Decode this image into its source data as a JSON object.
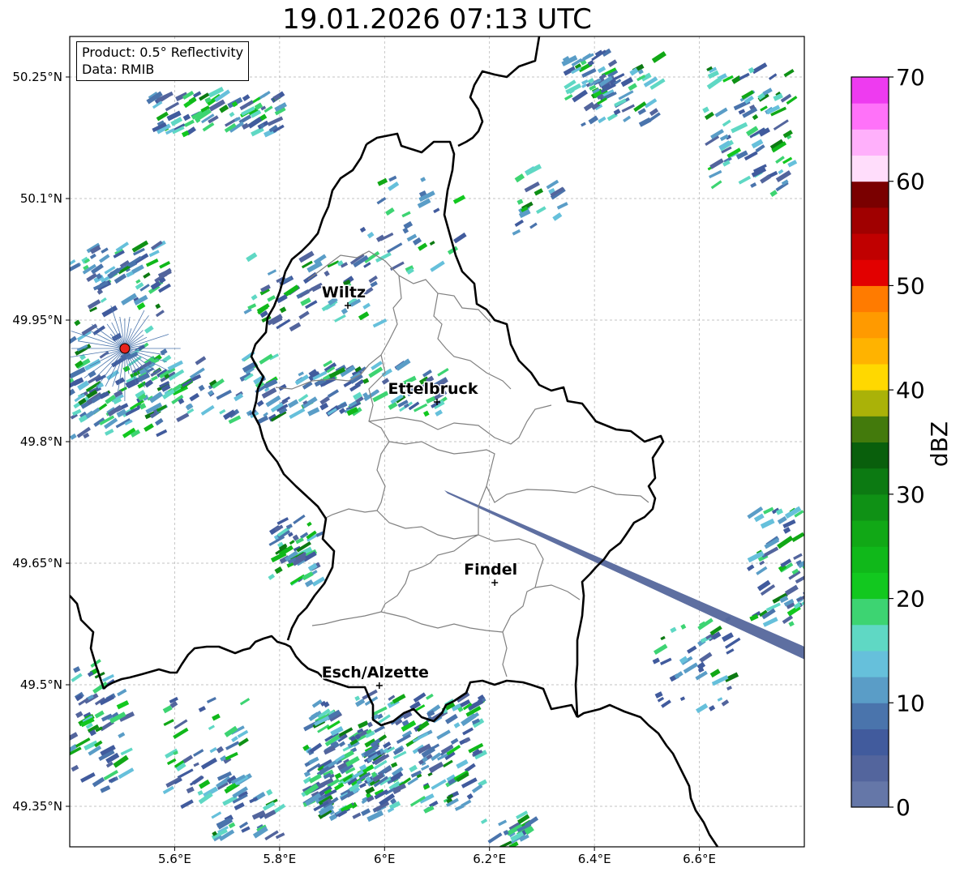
{
  "title": "19.01.2026 07:13 UTC",
  "info_box": {
    "product": "Product: 0.5° Reflectivity",
    "source": "Data: RMIB"
  },
  "map": {
    "lon_range": [
      5.4,
      6.8
    ],
    "lat_range": [
      49.3,
      50.3
    ],
    "lon_ticks": [
      5.6,
      5.8,
      6.0,
      6.2,
      6.4,
      6.6
    ],
    "lon_tick_labels": [
      "5.6°E",
      "5.8°E",
      "6°E",
      "6.2°E",
      "6.4°E",
      "6.6°E"
    ],
    "lat_ticks": [
      49.35,
      49.5,
      49.65,
      49.8,
      49.95,
      50.1,
      50.25
    ],
    "lat_tick_labels": [
      "49.35°N",
      "49.5°N",
      "49.65°N",
      "49.8°N",
      "49.95°N",
      "50.1°N",
      "50.25°N"
    ],
    "grid": true,
    "radar_site": {
      "lon": 5.505,
      "lat": 49.915,
      "color": "#e8231c"
    },
    "cities": [
      {
        "name": "Wiltz",
        "lon": 5.93,
        "lat": 49.968
      },
      {
        "name": "Ettelbruck",
        "lon": 6.1,
        "lat": 49.849
      },
      {
        "name": "Findel",
        "lon": 6.21,
        "lat": 49.626
      },
      {
        "name": "Esch/Alzette",
        "lon": 5.99,
        "lat": 49.499
      }
    ]
  },
  "colorbar": {
    "label": "dBZ",
    "min": 0,
    "max": 70,
    "step": 2.5,
    "tick_values": [
      0,
      10,
      20,
      30,
      40,
      50,
      60,
      70
    ],
    "tick_labels": [
      "0",
      "10",
      "20",
      "30",
      "40",
      "50",
      "60",
      "70"
    ],
    "colors": [
      "#6577a8",
      "#53659d",
      "#415b9d",
      "#4a74ac",
      "#5a9dc7",
      "#66c0db",
      "#5fd8c4",
      "#3dd472",
      "#12c81f",
      "#10b81a",
      "#11a816",
      "#0f9115",
      "#0c7a12",
      "#095f0c",
      "#437a0c",
      "#aab208",
      "#ffd800",
      "#ffb300",
      "#ff9a00",
      "#ff7b00",
      "#e20000",
      "#c00000",
      "#a00000",
      "#7a0000",
      "#ffddfb",
      "#ffb0fb",
      "#ff72f9",
      "#ee3bf0"
    ]
  }
}
